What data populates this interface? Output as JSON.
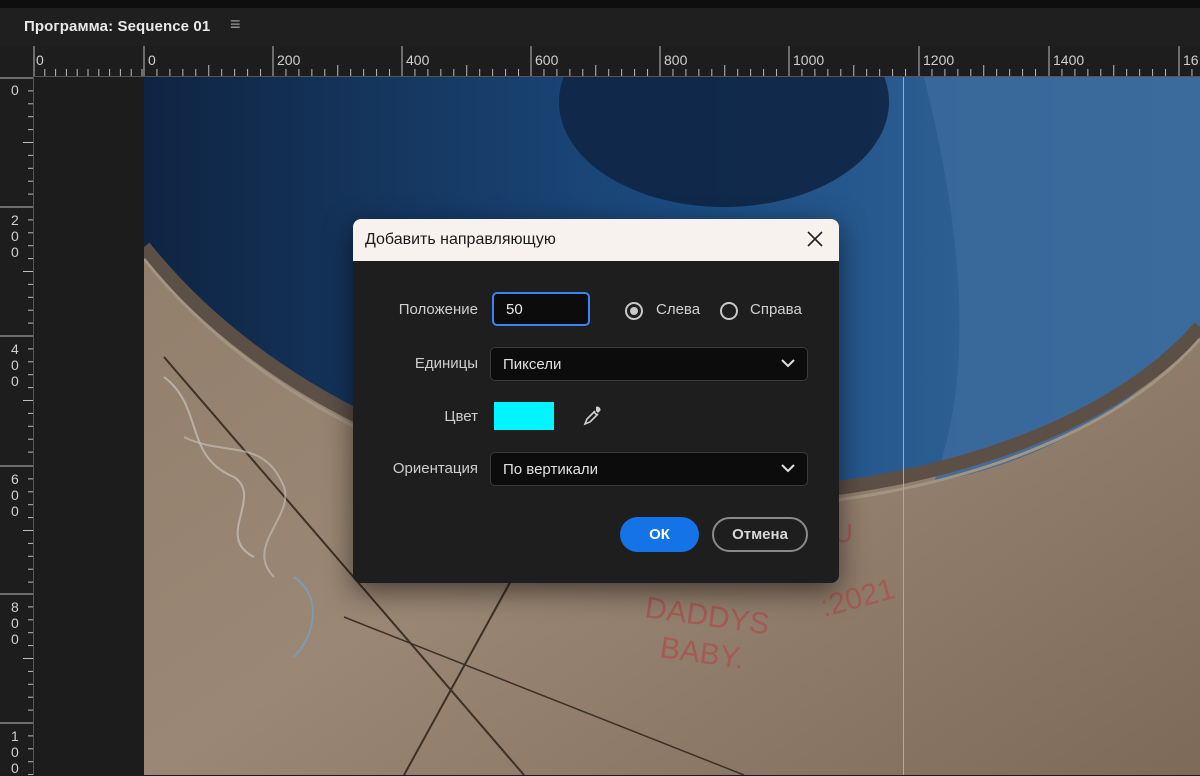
{
  "panel": {
    "title": "Программа: Sequence 01",
    "menu_icon": "hamburger-menu-icon"
  },
  "ruler_top": {
    "labels": [
      "0",
      "0",
      "200",
      "400",
      "600",
      "800",
      "1000",
      "1200",
      "1400",
      "16"
    ]
  },
  "ruler_left": {
    "labels": [
      [
        "0"
      ],
      [
        "2",
        "0",
        "0"
      ],
      [
        "4",
        "0",
        "0"
      ],
      [
        "6",
        "0",
        "0"
      ],
      [
        "8",
        "0",
        "0"
      ],
      [
        "1",
        "0",
        "0"
      ]
    ]
  },
  "guide": {
    "color": "#00f0ff"
  },
  "dialog": {
    "title": "Добавить направляющую",
    "position_label": "Положение",
    "position_value": "50",
    "radio_left_label": "Слева",
    "radio_right_label": "Справа",
    "radio_selected": "left",
    "units_label": "Единицы",
    "units_value": "Пиксели",
    "color_label": "Цвет",
    "color_value": "#00f5ff",
    "orientation_label": "Ориентация",
    "orientation_value": "По вертикали",
    "ok_label": "ОК",
    "cancel_label": "Отмена",
    "ok_color": "#1473e6"
  },
  "video_text": {
    "graffiti_1": "DADDYS",
    "graffiti_2": "BABY.",
    "graffiti_3": ":2021",
    "graffiti_4": "U"
  }
}
